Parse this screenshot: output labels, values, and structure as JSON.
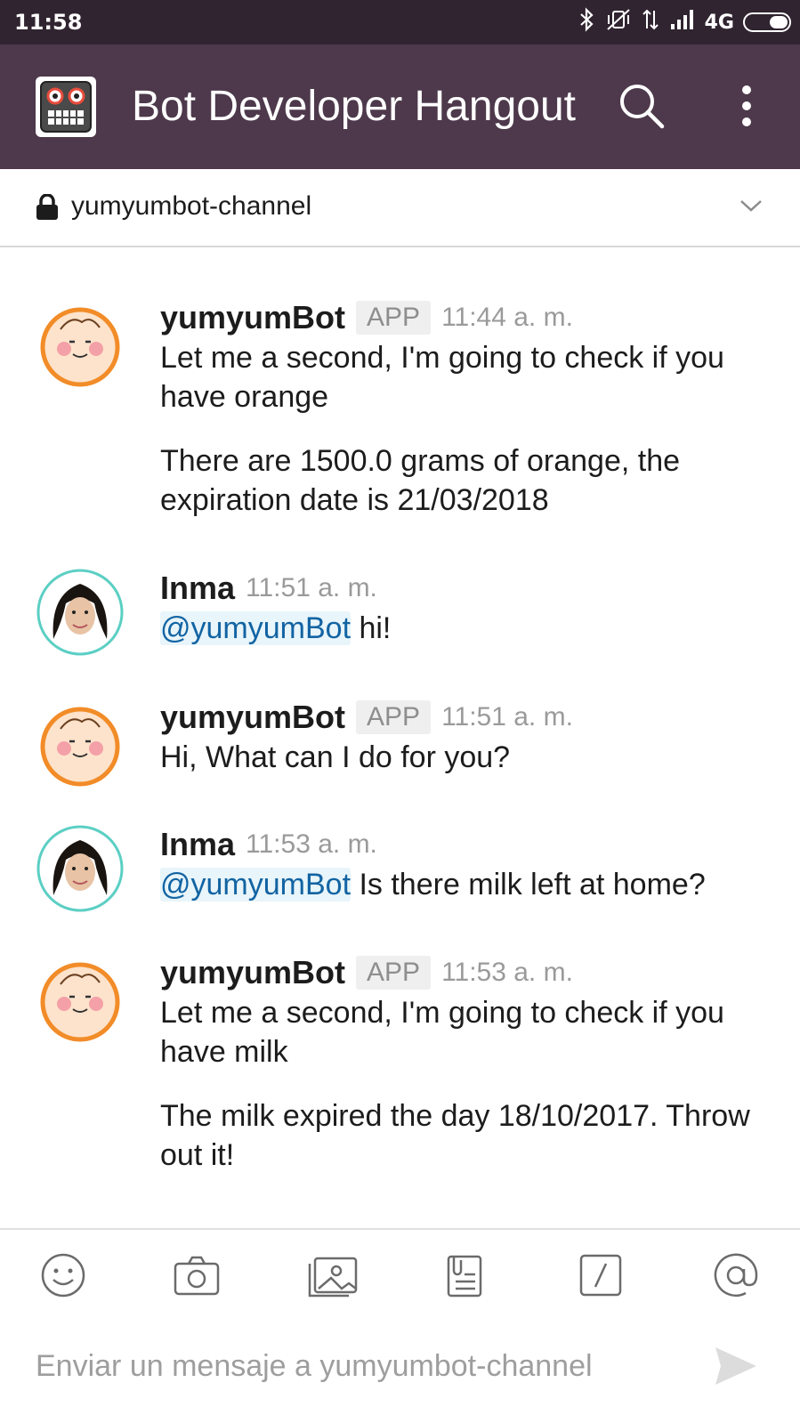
{
  "status_bar": {
    "time": "11:58",
    "network": "4G"
  },
  "app_bar": {
    "title": "Bot Developer Hangout"
  },
  "channel": {
    "name": "yumyumbot-channel"
  },
  "messages": [
    {
      "author": "yumyumBot",
      "badge": "APP",
      "time": "11:44 a. m.",
      "lines": [
        "Let me a second, I'm going to check if you have orange",
        "There are 1500.0 grams of orange, the expiration date is 21/03/2018"
      ]
    },
    {
      "author": "Inma",
      "time": "11:51 a. m.",
      "mention": "@yumyumBot",
      "text": " hi!"
    },
    {
      "author": "yumyumBot",
      "badge": "APP",
      "time": "11:51 a. m.",
      "lines": [
        "Hi, What can I do for you?"
      ]
    },
    {
      "author": "Inma",
      "time": "11:53 a. m.",
      "mention": "@yumyumBot",
      "text": " Is there milk left at home?"
    },
    {
      "author": "yumyumBot",
      "badge": "APP",
      "time": "11:53 a. m.",
      "lines": [
        "Let me a second, I'm going to check if you have milk",
        "The milk expired the day 18/10/2017. Throw out it!"
      ]
    }
  ],
  "composer": {
    "placeholder": "Enviar un mensaje a yumyumbot-channel"
  },
  "colors": {
    "status_bar_bg": "#302430",
    "app_bar_bg": "#4d394b",
    "mention_color": "#1264a3",
    "bot_avatar_ring": "#f28c28"
  }
}
